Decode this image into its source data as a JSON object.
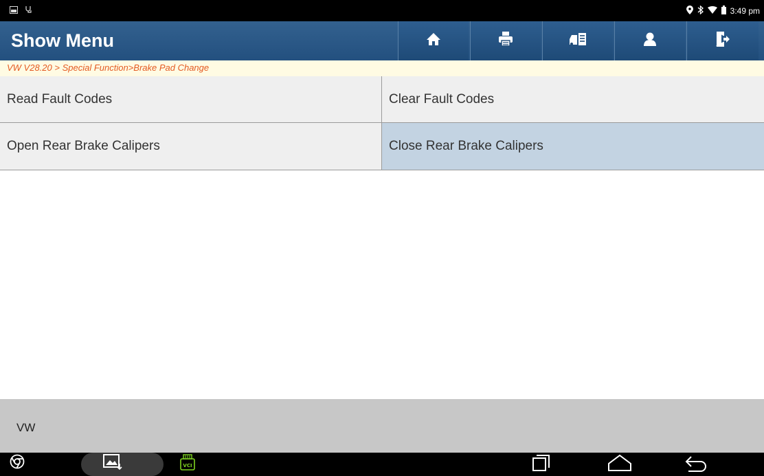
{
  "statusbar": {
    "left_icons": [
      "image-icon",
      "stethoscope-icon"
    ],
    "right_icons": [
      "location-icon",
      "bluetooth-icon",
      "wifi-icon",
      "battery-icon"
    ],
    "time": "3:49 pm"
  },
  "header": {
    "title": "Show Menu",
    "toolbar": [
      "home-icon",
      "print-icon",
      "car-report-icon",
      "user-icon",
      "exit-icon"
    ]
  },
  "breadcrumb": "VW V28.20 > Special Function>Brake Pad Change",
  "menu": {
    "items": [
      {
        "label": "Read Fault Codes"
      },
      {
        "label": "Clear Fault Codes"
      },
      {
        "label": "Open Rear Brake Calipers"
      },
      {
        "label": "Close Rear Brake Calipers",
        "selected": true
      }
    ]
  },
  "footer": {
    "vehicle": "VW"
  },
  "navbar": {
    "vci_label": "VCI",
    "icons": [
      "chrome-icon",
      "gallery-icon",
      "vci-icon",
      "recent-apps-icon",
      "home-nav-icon",
      "back-icon"
    ]
  },
  "colors": {
    "header_bg": "#2a5886",
    "breadcrumb_text": "#e45a22",
    "selected_row": "#c3d3e2"
  }
}
